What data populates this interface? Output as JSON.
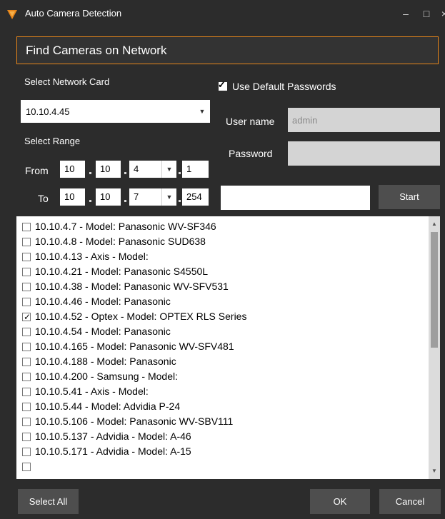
{
  "window": {
    "title": "Auto Camera Detection",
    "minimize_glyph": "–",
    "maximize_glyph": "□",
    "close_glyph": "×"
  },
  "header": {
    "title": "Find Cameras on Network"
  },
  "network": {
    "label": "Select Network Card",
    "selected": "10.10.4.45",
    "dropdown_glyph": "▼"
  },
  "range": {
    "label": "Select Range",
    "from_label": "From",
    "to_label": "To",
    "from": [
      "10",
      "10",
      "4",
      "1"
    ],
    "to": [
      "10",
      "10",
      "7",
      "254"
    ]
  },
  "credentials": {
    "use_default_label": "Use Default Passwords",
    "use_default_checked": true,
    "username_label": "User name",
    "username_value": "admin",
    "password_label": "Password",
    "password_value": ""
  },
  "status_field": "",
  "buttons": {
    "start": "Start",
    "select_all": "Select All",
    "ok": "OK",
    "cancel": "Cancel"
  },
  "cameras": [
    {
      "label": "10.10.4.7 - Model: Panasonic WV-SF346",
      "checked": false
    },
    {
      "label": "10.10.4.8 - Model: Panasonic SUD638",
      "checked": false
    },
    {
      "label": "10.10.4.13 - Axis - Model:",
      "checked": false
    },
    {
      "label": "10.10.4.21 - Model: Panasonic S4550L",
      "checked": false
    },
    {
      "label": "10.10.4.38 - Model: Panasonic WV-SFV531",
      "checked": false
    },
    {
      "label": "10.10.4.46 - Model: Panasonic",
      "checked": false
    },
    {
      "label": "10.10.4.52 - Optex - Model: OPTEX RLS Series",
      "checked": true
    },
    {
      "label": "10.10.4.54 - Model: Panasonic",
      "checked": false
    },
    {
      "label": "10.10.4.165 - Model: Panasonic WV-SFV481",
      "checked": false
    },
    {
      "label": "10.10.4.188 - Model: Panasonic",
      "checked": false
    },
    {
      "label": "10.10.4.200 - Samsung - Model:",
      "checked": false
    },
    {
      "label": "10.10.5.41 - Axis - Model:",
      "checked": false
    },
    {
      "label": "10.10.5.44 - Model: Advidia P-24",
      "checked": false
    },
    {
      "label": "10.10.5.106 - Model: Panasonic WV-SBV111",
      "checked": false
    },
    {
      "label": "10.10.5.137 - Advidia - Model: A-46",
      "checked": false
    },
    {
      "label": "10.10.5.171 - Advidia - Model: A-15",
      "checked": false
    },
    {
      "label": "",
      "checked": false
    }
  ],
  "colors": {
    "accent": "#e8861a",
    "window_bg": "#2c2c2c",
    "button_bg": "#4e4e4e"
  }
}
